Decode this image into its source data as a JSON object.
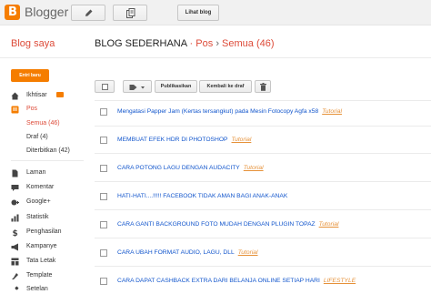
{
  "topbar": {
    "brand": "Blogger",
    "logo_letter": "B",
    "lihat_blog": "Lihat blog"
  },
  "header": {
    "blog_saya": "Blog saya",
    "blog_name": "BLOG SEDERHANA",
    "sep1": "·",
    "section": "Pos",
    "sep2": "›",
    "filter": "Semua (46)"
  },
  "sidebar": {
    "new_post": "Entri baru",
    "items": [
      {
        "label": "Ikhtisar",
        "icon": "home-icon"
      },
      {
        "label": "Pos",
        "icon": "posts-icon"
      },
      {
        "label": "Laman",
        "icon": "page-icon"
      },
      {
        "label": "Komentar",
        "icon": "comment-icon"
      },
      {
        "label": "Google+",
        "icon": "google-plus-icon"
      },
      {
        "label": "Statistik",
        "icon": "stats-icon"
      },
      {
        "label": "Penghasilan",
        "icon": "dollar-icon"
      },
      {
        "label": "Kampanye",
        "icon": "megaphone-icon"
      },
      {
        "label": "Tata Letak",
        "icon": "layout-icon"
      },
      {
        "label": "Template",
        "icon": "template-icon"
      },
      {
        "label": "Setelan",
        "icon": "wrench-icon"
      }
    ],
    "sub_items": [
      {
        "label": "Semua (46)"
      },
      {
        "label": "Draf (4)"
      },
      {
        "label": "Diterbitkan (42)"
      }
    ]
  },
  "toolbar": {
    "publish": "Publikasikan",
    "revert": "Kembali ke draf"
  },
  "posts": [
    {
      "title": "Mengatasi Papper Jam (Kertas tersangkut) pada Mesin Fotocopy Agfa x58",
      "tag": "Tutorial"
    },
    {
      "title": "MEMBUAT EFEK HDR DI PHOTOSHOP",
      "tag": "Tutorial"
    },
    {
      "title": "CARA POTONG LAGU DENGAN AUDACITY",
      "tag": "Tutorial"
    },
    {
      "title": "HATI-HATI....!!!!! FACEBOOK TIDAK AMAN BAGI ANAK-ANAK",
      "tag": ""
    },
    {
      "title": "CARA GANTI BACKGROUND FOTO MUDAH DENGAN PLUGIN TOPAZ",
      "tag": "Tutorial"
    },
    {
      "title": "CARA UBAH FORMAT AUDIO, LAGU, DLL",
      "tag": "Tutorial"
    },
    {
      "title": "CARA DAPAT CASHBACK EXTRA DARI BELANJA ONLINE SETIAP HARI",
      "tag": "LIFESTYLE"
    }
  ],
  "colors": {
    "accent": "#f57d00",
    "active_text": "#dd4b39",
    "link": "#1155cc",
    "tag": "#e69138"
  }
}
